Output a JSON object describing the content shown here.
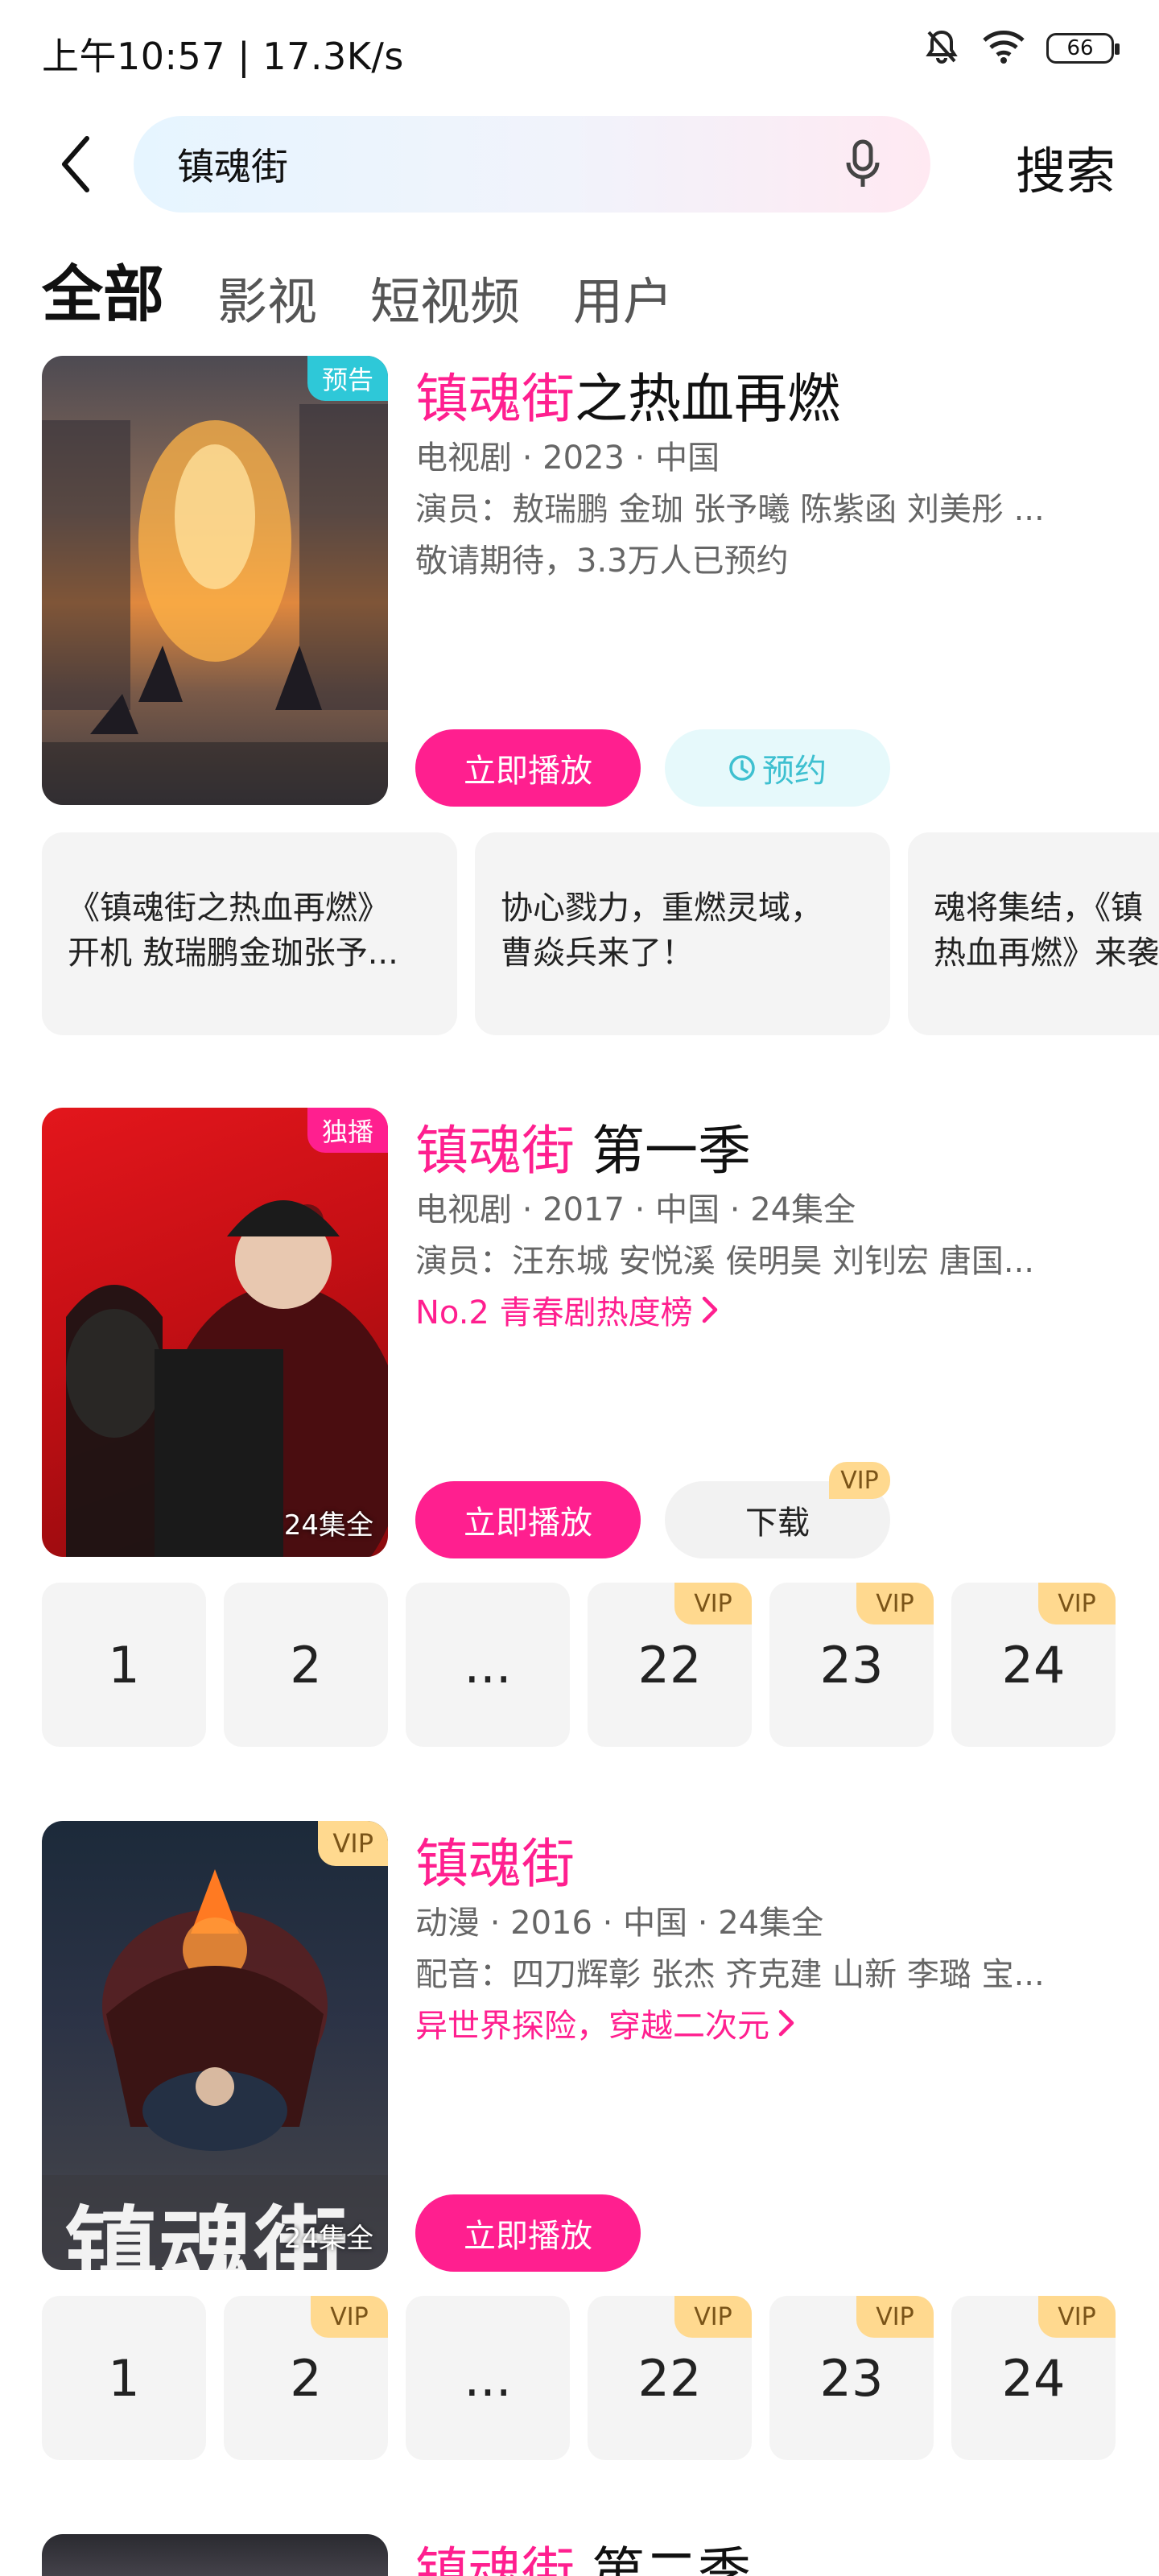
{
  "status": {
    "time_speed": "上午10:57 | 17.3K/s",
    "battery": "66"
  },
  "search": {
    "value": "镇魂街",
    "button": "搜索"
  },
  "tabs": [
    {
      "label": "全部",
      "active": true
    },
    {
      "label": "影视",
      "active": false
    },
    {
      "label": "短视频",
      "active": false
    },
    {
      "label": "用户",
      "active": false
    }
  ],
  "colors": {
    "accent": "#ff1f8f",
    "vip": "#ffd98f",
    "teaser": "#3ec0d0"
  },
  "results": [
    {
      "badge": "预告",
      "title_hl": "镇魂街",
      "title_rest": "之热血再燃",
      "meta": "电视剧 · 2023 · 中国",
      "cast": "演员：敖瑞鹏 金珈 张予曦 陈紫函 刘美彤 ...",
      "note": "敬请期待，3.3万人已预约",
      "play": "立即播放",
      "reserve": "预约",
      "news": [
        [
          "《镇魂街之热血再燃》",
          "开机 敖瑞鹏金珈张予..."
        ],
        [
          "协心戮力，重燃灵域，",
          "曹焱兵来了！"
        ],
        [
          "魂将集结，《镇",
          "热血再燃》来袭"
        ]
      ]
    },
    {
      "badge": "独播",
      "count": "24集全",
      "title_hl": "镇魂街",
      "title_rest": " 第一季",
      "meta": "电视剧 · 2017 · 中国 · 24集全",
      "cast": "演员：汪东城 安悦溪 侯明昊 刘钊宏 唐国...",
      "rank": "No.2 青春剧热度榜",
      "play": "立即播放",
      "download": "下载",
      "vip": "VIP",
      "episodes": [
        "1",
        "2",
        "...",
        "22",
        "23",
        "24"
      ]
    },
    {
      "badge": "VIP",
      "count": "24集全",
      "poster_text": "镇魂街",
      "title_hl": "镇魂街",
      "title_rest": "",
      "meta": "动漫 · 2016 · 中国 · 24集全",
      "cast": "配音：四刀辉彰 张杰 齐克建 山新 李璐 宝...",
      "rank": "异世界探险，穿越二次元",
      "play": "立即播放",
      "vip": "VIP",
      "episodes": [
        "1",
        "2",
        "...",
        "22",
        "23",
        "24"
      ]
    },
    {
      "title_hl": "镇魂街",
      "title_rest": " 第二季"
    }
  ]
}
